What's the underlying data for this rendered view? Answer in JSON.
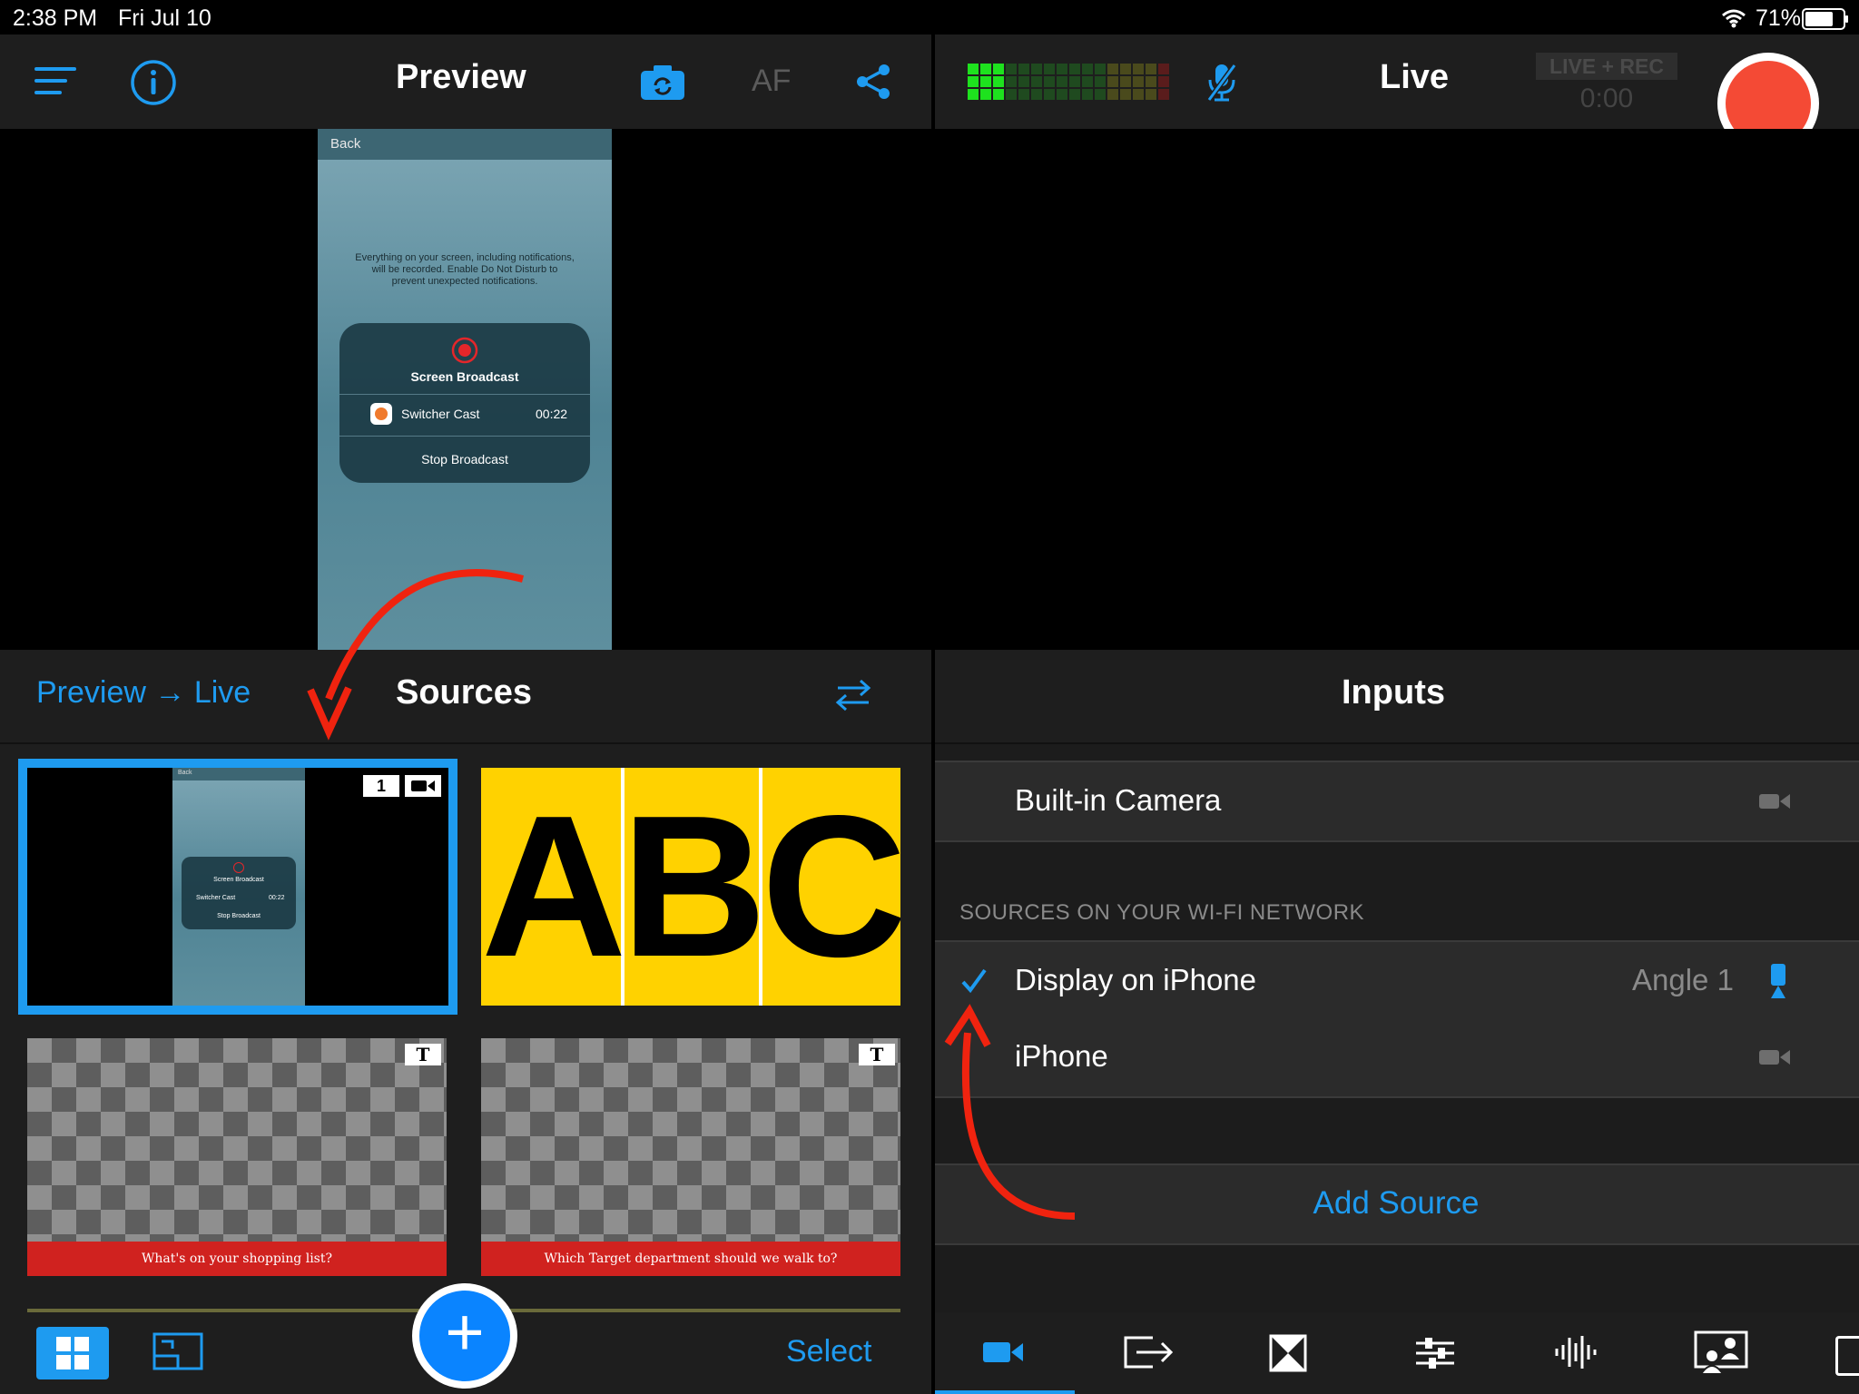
{
  "status_bar": {
    "time": "2:38 PM",
    "date": "Fri Jul 10",
    "battery_pct": "71%"
  },
  "preview_header": {
    "title": "Preview",
    "af_label": "AF"
  },
  "live_header": {
    "title": "Live",
    "live_rec_badge": "LIVE + REC",
    "timer": "0:00"
  },
  "preview_screen": {
    "back": "Back",
    "message": "Everything on your screen, including notifications, will be recorded. Enable Do Not Disturb to prevent unexpected notifications.",
    "broadcast_title": "Screen Broadcast",
    "app_name": "Switcher Cast",
    "elapsed": "00:22",
    "stop": "Stop Broadcast"
  },
  "sources_panel": {
    "left_link_preview": "Preview",
    "left_link_arrow": "→",
    "left_link_live": "Live",
    "title": "Sources",
    "thumbnails": [
      {
        "badge_number": "1",
        "thumb_back": "Back",
        "thumb_title": "Screen Broadcast",
        "thumb_app": "Switcher Cast",
        "thumb_time": "00:22",
        "thumb_stop": "Stop Broadcast"
      },
      {
        "letters": "ABC"
      },
      {
        "badge": "T",
        "caption": "What's on your shopping list?"
      },
      {
        "badge": "T",
        "caption": "Which Target department should we walk to?"
      }
    ],
    "add_label": "+",
    "select_label": "Select"
  },
  "inputs_panel": {
    "title": "Inputs",
    "builtin": {
      "label": "Built-in Camera"
    },
    "section_header": "SOURCES ON YOUR WI-FI NETWORK",
    "wifi_sources": [
      {
        "label": "Display on iPhone",
        "detail": "Angle 1",
        "checked": true
      },
      {
        "label": "iPhone",
        "detail": "",
        "checked": false
      }
    ],
    "add_source": "Add Source"
  },
  "colors": {
    "accent": "#1e9bf0",
    "record": "#f44a35",
    "annotation_arrow": "#f0230f",
    "caption_bar": "#d0221f",
    "abc_yellow": "#ffd200"
  }
}
